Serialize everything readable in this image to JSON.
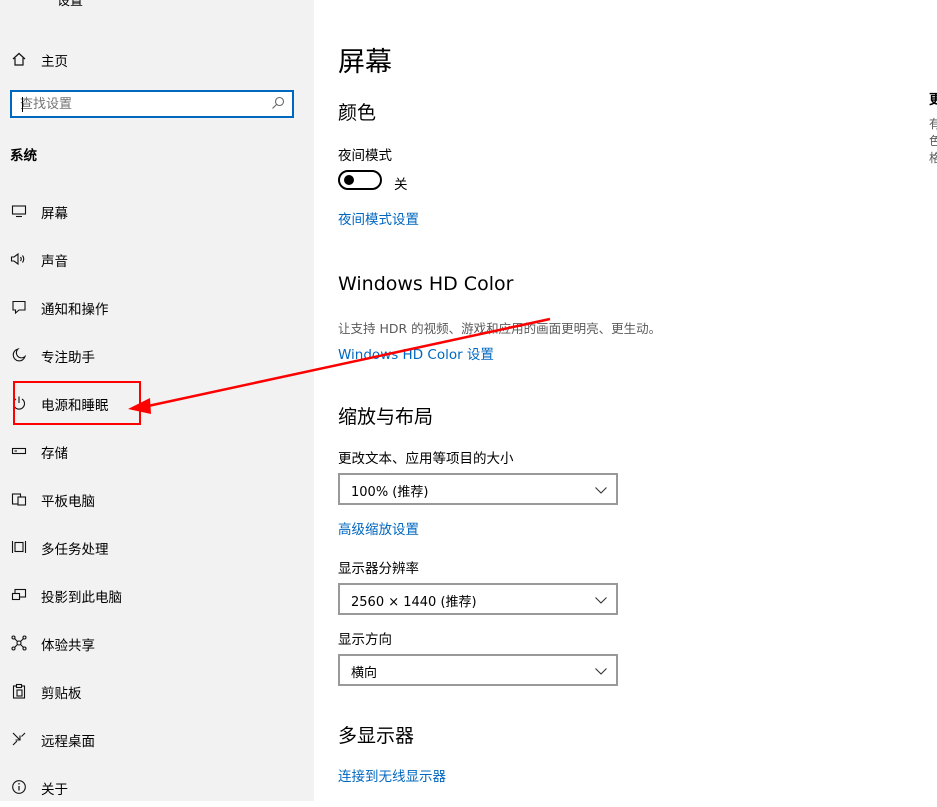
{
  "window": {
    "title": "设置"
  },
  "sidebar": {
    "home_label": "主页",
    "search_placeholder": "查找设置",
    "section": "系统",
    "items": [
      {
        "label": "屏幕",
        "icon": "monitor-icon"
      },
      {
        "label": "声音",
        "icon": "speaker-icon"
      },
      {
        "label": "通知和操作",
        "icon": "notification-icon"
      },
      {
        "label": "专注助手",
        "icon": "moon-icon"
      },
      {
        "label": "电源和睡眠",
        "icon": "power-icon"
      },
      {
        "label": "存储",
        "icon": "storage-icon"
      },
      {
        "label": "平板电脑",
        "icon": "tablet-icon"
      },
      {
        "label": "多任务处理",
        "icon": "multitask-icon"
      },
      {
        "label": "投影到此电脑",
        "icon": "project-icon"
      },
      {
        "label": "体验共享",
        "icon": "share-icon"
      },
      {
        "label": "剪贴板",
        "icon": "clipboard-icon"
      },
      {
        "label": "远程桌面",
        "icon": "remote-icon"
      },
      {
        "label": "关于",
        "icon": "info-icon"
      }
    ]
  },
  "main": {
    "title": "屏幕",
    "color_section": {
      "heading": "颜色",
      "night_light_label": "夜间模式",
      "night_light_state": "关",
      "night_light_link": "夜间模式设置"
    },
    "hdr_section": {
      "heading": "Windows HD Color",
      "desc": "让支持 HDR 的视频、游戏和应用的画面更明亮、更生动。",
      "link": "Windows HD Color 设置"
    },
    "scale_section": {
      "heading": "缩放与布局",
      "scale_label": "更改文本、应用等项目的大小",
      "scale_value": "100% (推荐)",
      "advanced_link": "高级缩放设置",
      "resolution_label": "显示器分辨率",
      "resolution_value": "2560 × 1440 (推荐)",
      "orientation_label": "显示方向",
      "orientation_value": "横向"
    },
    "multi_section": {
      "heading": "多显示器",
      "link": "连接到无线显示器"
    }
  },
  "right_panel": {
    "title": "更",
    "lines": [
      "有",
      "色",
      "格"
    ]
  },
  "annotation": {
    "color": "#ff0000"
  },
  "colors": {
    "accent": "#0067c0",
    "sidebar_bg": "#f2f2f2"
  }
}
